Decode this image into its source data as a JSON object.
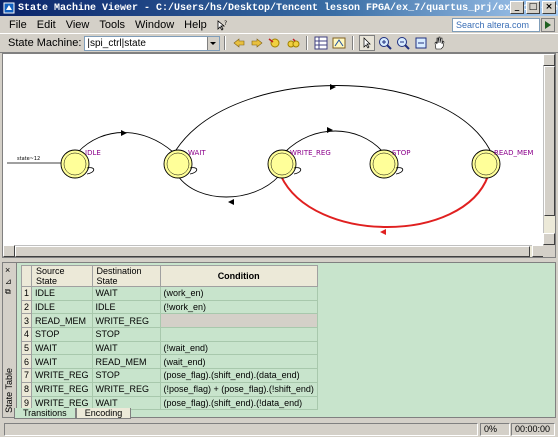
{
  "window": {
    "title": "State Machine Viewer - C:/Users/hs/Desktop/Tencent lesson FPGA/ex_7/quartus_prj/ex_spi - ex_spi",
    "controls": [
      "_",
      "□",
      "×"
    ]
  },
  "menu": {
    "items": [
      "File",
      "Edit",
      "View",
      "Tools",
      "Window",
      "Help"
    ],
    "search_placeholder": "Search altera.com"
  },
  "toolbar": {
    "label": "State Machine:",
    "selected_machine": "|spi_ctrl|state"
  },
  "diagram": {
    "reset_label": "state~12",
    "states": [
      "IDLE",
      "WAIT",
      "WRITE_REG",
      "STOP",
      "READ_MEM"
    ],
    "highlight_color": "#e02020",
    "state_fill": "#ffff99"
  },
  "table": {
    "headers": [
      "Source State",
      "Destination State",
      "Condition"
    ],
    "rows": [
      {
        "n": "1",
        "src": "IDLE",
        "dst": "WAIT",
        "cond": "(work_en)"
      },
      {
        "n": "2",
        "src": "IDLE",
        "dst": "IDLE",
        "cond": "(!work_en)"
      },
      {
        "n": "3",
        "src": "READ_MEM",
        "dst": "WRITE_REG",
        "cond": ""
      },
      {
        "n": "4",
        "src": "STOP",
        "dst": "STOP",
        "cond": ""
      },
      {
        "n": "5",
        "src": "WAIT",
        "dst": "WAIT",
        "cond": "(!wait_end)"
      },
      {
        "n": "6",
        "src": "WAIT",
        "dst": "READ_MEM",
        "cond": "(wait_end)"
      },
      {
        "n": "7",
        "src": "WRITE_REG",
        "dst": "STOP",
        "cond": "(pose_flag).(shift_end).(data_end)"
      },
      {
        "n": "8",
        "src": "WRITE_REG",
        "dst": "WRITE_REG",
        "cond": "(!pose_flag) + (pose_flag).(!shift_end)"
      },
      {
        "n": "9",
        "src": "WRITE_REG",
        "dst": "WAIT",
        "cond": "(pose_flag).(shift_end).(!data_end)"
      }
    ]
  },
  "panel": {
    "side_label": "State Table",
    "close": "×",
    "tabs": [
      "Transitions",
      "Encoding"
    ]
  },
  "status": {
    "progress": "0%",
    "time": "00:00:00"
  }
}
